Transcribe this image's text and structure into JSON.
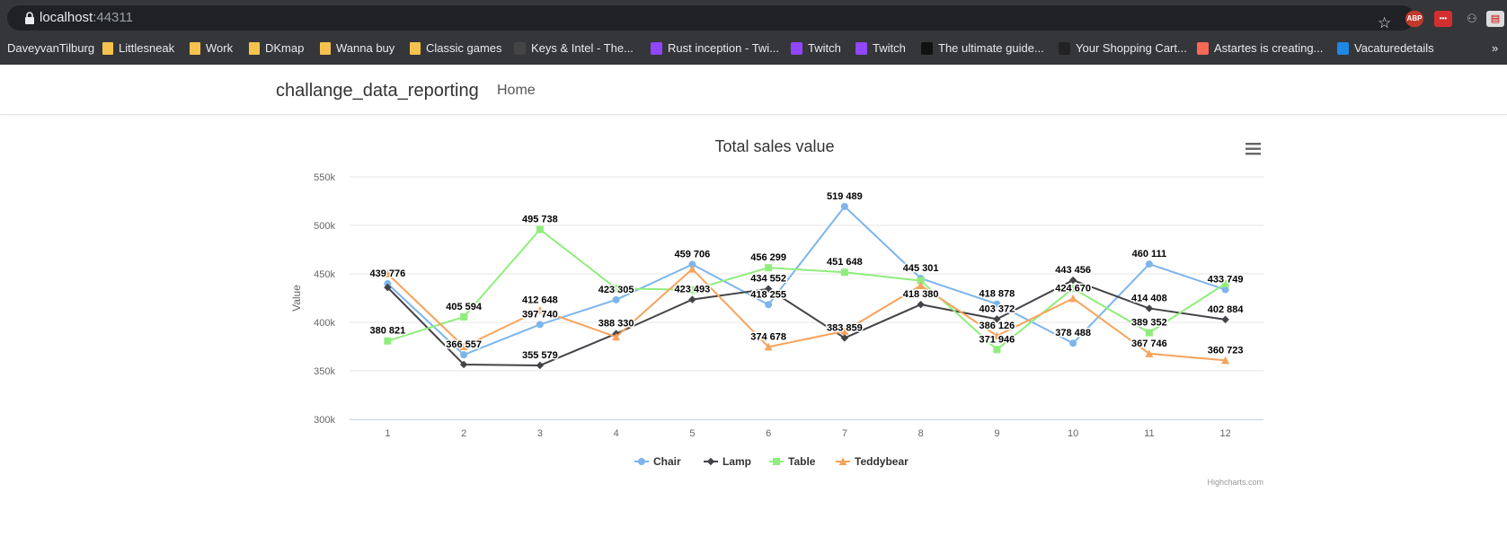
{
  "browser": {
    "url_host": "localhost",
    "url_port": ":44311",
    "extensions": [
      "ABP",
      "•••"
    ],
    "bookmarks": [
      {
        "label": "DaveyvanTilburg",
        "icon": "none"
      },
      {
        "label": "Littlesneak",
        "icon": "folder"
      },
      {
        "label": "Work",
        "icon": "folder"
      },
      {
        "label": "DKmap",
        "icon": "folder"
      },
      {
        "label": "Wanna buy",
        "icon": "folder"
      },
      {
        "label": "Classic games",
        "icon": "folder"
      },
      {
        "label": "Keys & Intel - The...",
        "icon": "game"
      },
      {
        "label": "Rust inception - Twi...",
        "icon": "twitch"
      },
      {
        "label": "Twitch",
        "icon": "twitch"
      },
      {
        "label": "Twitch",
        "icon": "twitch"
      },
      {
        "label": "The ultimate guide...",
        "icon": "bw"
      },
      {
        "label": "Your Shopping Cart...",
        "icon": "cart"
      },
      {
        "label": "Astartes is creating...",
        "icon": "patreon"
      },
      {
        "label": "Vacaturedetails",
        "icon": "vac"
      }
    ]
  },
  "app": {
    "brand": "challange_data_reporting",
    "nav_home": "Home"
  },
  "chart_data": {
    "type": "line",
    "title": "Total sales value",
    "xlabel": "",
    "ylabel": "Value",
    "x": [
      1,
      2,
      3,
      4,
      5,
      6,
      7,
      8,
      9,
      10,
      11,
      12
    ],
    "ylim": [
      300000,
      550000
    ],
    "yticks": [
      300000,
      350000,
      400000,
      450000,
      500000,
      550000
    ],
    "ytick_labels": [
      "300k",
      "350k",
      "400k",
      "450k",
      "500k",
      "550k"
    ],
    "grid": true,
    "legend": "bottom-center",
    "credits": "Highcharts.com",
    "series": [
      {
        "name": "Chair",
        "color": "#7cb5ec",
        "marker": "circle",
        "values": [
          439776,
          366557,
          397740,
          423305,
          459706,
          418255,
          519489,
          445301,
          418878,
          378488,
          460111,
          433749
        ],
        "labels": [
          true,
          true,
          true,
          true,
          true,
          true,
          true,
          true,
          true,
          true,
          true,
          true
        ]
      },
      {
        "name": "Lamp",
        "color": "#434348",
        "marker": "diamond",
        "values": [
          436000,
          356500,
          355579,
          388330,
          423493,
          434552,
          383859,
          418380,
          403372,
          443456,
          414408,
          402884
        ],
        "labels": [
          false,
          false,
          true,
          true,
          true,
          true,
          true,
          true,
          true,
          true,
          true,
          true
        ]
      },
      {
        "name": "Table",
        "color": "#90ed7d",
        "marker": "square",
        "values": [
          380821,
          405594,
          495738,
          435000,
          433500,
          456299,
          451648,
          443000,
          371946,
          435000,
          389352,
          440000
        ],
        "labels": [
          true,
          true,
          true,
          false,
          false,
          true,
          true,
          false,
          true,
          false,
          true,
          false
        ]
      },
      {
        "name": "Teddybear",
        "color": "#f7a35c",
        "marker": "triangle",
        "values": [
          450000,
          375000,
          412648,
          385000,
          455000,
          374678,
          391000,
          438000,
          386126,
          424670,
          367746,
          360723
        ],
        "labels": [
          false,
          false,
          true,
          false,
          false,
          true,
          false,
          false,
          true,
          true,
          true,
          true
        ]
      }
    ]
  }
}
